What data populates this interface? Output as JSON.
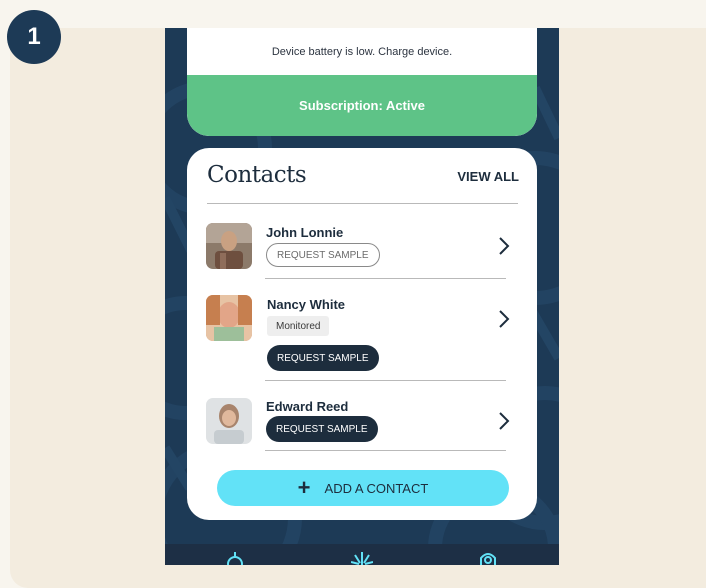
{
  "step_number": "1",
  "status": {
    "battery_message": "Device battery is low. Charge device.",
    "subscription_label": "Subscription: Active"
  },
  "contacts": {
    "title": "Contacts",
    "view_all_label": "VIEW ALL",
    "items": [
      {
        "name": "John Lonnie",
        "request_label": "REQUEST SAMPLE",
        "request_style": "outline"
      },
      {
        "name": "Nancy White",
        "badge": "Monitored",
        "request_label": "REQUEST SAMPLE",
        "request_style": "filled"
      },
      {
        "name": "Edward Reed",
        "request_label": "REQUEST SAMPLE",
        "request_style": "filled"
      }
    ],
    "add_label": "ADD A CONTACT"
  },
  "tab_bar": {
    "icons": [
      "device-icon",
      "activity-icon",
      "settings-icon"
    ]
  },
  "colors": {
    "phone_bg": "#1d3a56",
    "subscription_green": "#5ec387",
    "add_button_cyan": "#62e2f7",
    "dark_button": "#1d2d3d",
    "badge_navy": "#1d3a56",
    "page_bg": "#f3ecdf"
  }
}
